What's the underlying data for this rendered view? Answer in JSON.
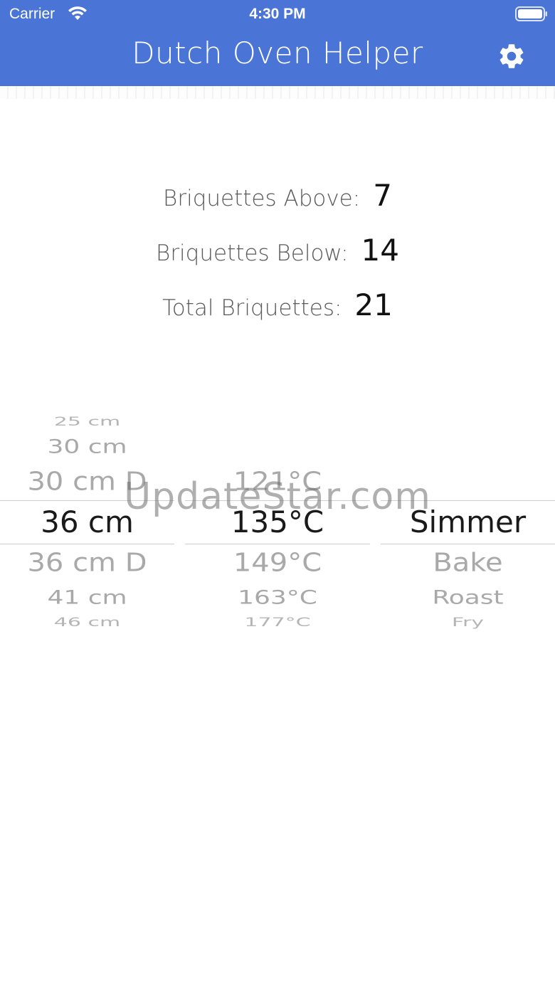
{
  "status_bar": {
    "carrier": "Carrier",
    "time": "4:30 PM"
  },
  "nav": {
    "title": "Dutch Oven Helper",
    "settings_icon": "gear-icon"
  },
  "results": {
    "above_label": "Briquettes Above:",
    "above_value": "7",
    "below_label": "Briquettes Below:",
    "below_value": "14",
    "total_label": "Total Briquettes:",
    "total_value": "21"
  },
  "picker": {
    "size": {
      "items": [
        "25 cm",
        "30 cm",
        "30 cm D",
        "36 cm",
        "36 cm D",
        "41 cm",
        "46 cm"
      ],
      "selected": "36 cm"
    },
    "temperature": {
      "items": [
        "121°C",
        "135°C",
        "149°C",
        "163°C",
        "177°C"
      ],
      "selected": "135°C"
    },
    "method": {
      "items": [
        "Simmer",
        "Bake",
        "Roast",
        "Fry"
      ],
      "selected": "Simmer"
    }
  },
  "watermark": "UpdateStar.com",
  "colors": {
    "header": "#4a74d6",
    "selected_text": "#1a1a1a",
    "unselected_text": "#a9a9a9"
  }
}
